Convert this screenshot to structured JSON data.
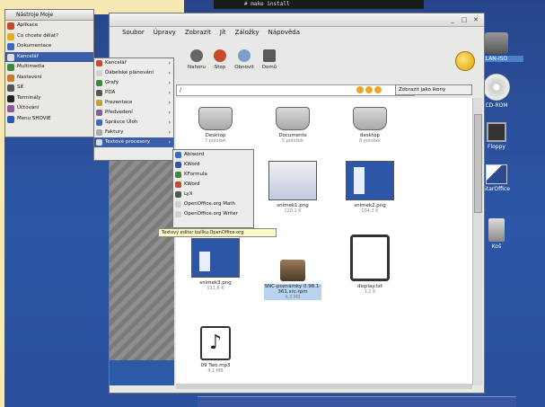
{
  "colors": {
    "desktop": "#2b4b8f",
    "menu_highlight": "#3a5ea8",
    "tooltip": "#fffbc8"
  },
  "terminal": {
    "text": "# make install"
  },
  "desktop_icons": [
    {
      "label": "LAN-ISO"
    },
    {
      "label": "CD-ROM"
    },
    {
      "label": "Floppy"
    },
    {
      "label": "StarOffice"
    },
    {
      "label": "Koš"
    }
  ],
  "kmenu": {
    "header": "Nástroje   Moje",
    "items": [
      {
        "label": "Aplikace",
        "icon": "app-icon"
      },
      {
        "label": "Co chcete dělat?",
        "icon": "question-icon"
      },
      {
        "label": "Dokumentace",
        "icon": "docs-icon"
      },
      {
        "label": "Kancelář",
        "icon": "office-icon",
        "active": true
      },
      {
        "label": "Multimedia",
        "icon": "multimedia-icon"
      },
      {
        "label": "Nastavení",
        "icon": "settings-icon"
      },
      {
        "label": "Síť",
        "icon": "network-icon"
      },
      {
        "label": "Terminály",
        "icon": "terminal-icon"
      },
      {
        "label": "Účtování",
        "icon": "accounts-icon"
      },
      {
        "label": "Menu SHOVIE",
        "icon": "menu-icon"
      }
    ]
  },
  "submenu_office": {
    "items": [
      {
        "label": "Kancelář"
      },
      {
        "label": "Ďábelské plánování"
      },
      {
        "label": "Grafy"
      },
      {
        "label": "PDA"
      },
      {
        "label": "Prezentace"
      },
      {
        "label": "Předvedení"
      },
      {
        "label": "Správce Úloh"
      },
      {
        "label": "Faktury"
      },
      {
        "label": "Textové procesory",
        "active": true
      }
    ]
  },
  "submenu_text": {
    "items": [
      {
        "label": "Abiword"
      },
      {
        "label": "KWord"
      },
      {
        "label": "KFormula"
      },
      {
        "label": "KWord"
      },
      {
        "label": "LyX"
      },
      {
        "label": "OpenOffice.org Math"
      },
      {
        "label": "OpenOffice.org Writer"
      }
    ]
  },
  "tooltip": "Textový editor balíku OpenOffice.org",
  "window": {
    "menu": [
      "Soubor",
      "Úpravy",
      "Zobrazit",
      "Jít",
      "Záložky",
      "Nápověda"
    ],
    "toolbar": [
      "Nahoru",
      "Stop",
      "Obnovit",
      "Domů"
    ],
    "location": "/",
    "view_as": "Zobrazit jako ikony",
    "files": [
      {
        "name": "Desktop",
        "sub": "7 položek"
      },
      {
        "name": "Documents",
        "sub": "5 položek"
      },
      {
        "name": "desktop",
        "sub": "8 položek"
      },
      {
        "name": "snímek1.png",
        "sub": "120,1 K"
      },
      {
        "name": "snímek2.png",
        "sub": "104,3 K"
      },
      {
        "name": "snímek3.png",
        "sub": "111,6 K"
      },
      {
        "name": "SNC-poznámky 0.98.1-361.src.rpm",
        "sub": "4,3 MB"
      },
      {
        "name": "display.txt",
        "sub": "1,1 K"
      },
      {
        "name": "09 Two.mp3",
        "sub": "4,1 MB"
      }
    ]
  }
}
